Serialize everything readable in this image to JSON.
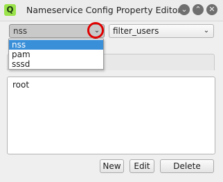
{
  "window": {
    "title": "Nameservice Config Property Editor",
    "app_icon_letter": "Q",
    "minimize_glyph": "⌄",
    "maximize_glyph": "⌃",
    "close_glyph": "✕"
  },
  "combos": {
    "service_selected": "nss",
    "property_selected": "filter_users",
    "arrow_glyph": "⌄"
  },
  "dropdown": {
    "options": [
      "nss",
      "pam",
      "sssd"
    ],
    "selected_index": 0
  },
  "values_text": "root",
  "buttons": {
    "new": "New",
    "edit": "Edit",
    "delete": "Delete"
  },
  "colors": {
    "highlight": "#3a8fd9",
    "annotation_circle": "#e00000",
    "app_icon": "#9be34b"
  }
}
